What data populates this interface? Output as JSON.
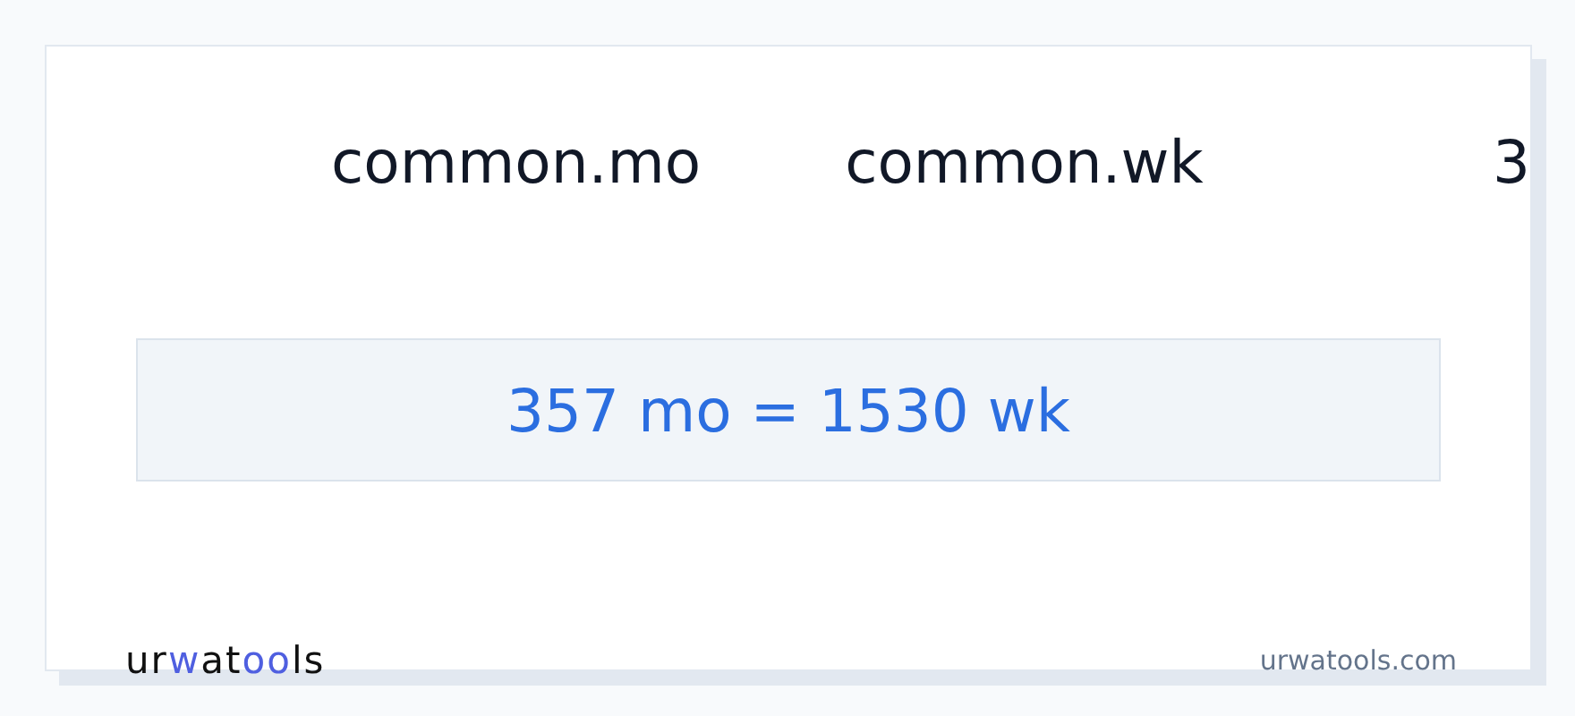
{
  "headers": [
    "common.mo",
    "common.wk",
    "3"
  ],
  "result": "357 mo = 1530 wk",
  "logo": [
    {
      "text": "ur",
      "accent": false
    },
    {
      "text": "w",
      "accent": true
    },
    {
      "text": "at",
      "accent": false
    },
    {
      "text": "oo",
      "accent": true
    },
    {
      "text": "ls",
      "accent": false
    }
  ],
  "site": "urwatools.com"
}
